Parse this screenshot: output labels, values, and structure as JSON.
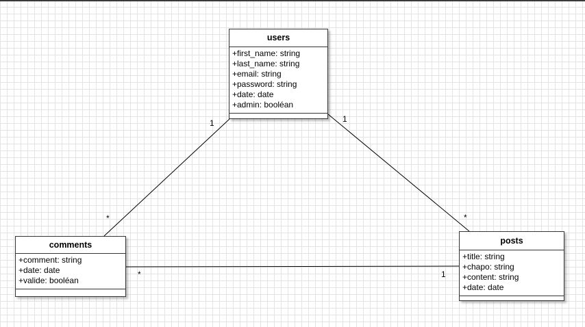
{
  "classes": {
    "users": {
      "name": "users",
      "attributes": [
        "+first_name: string",
        "+last_name: string",
        "+email: string",
        "+password: string",
        "+date: date",
        "+admin: booléan"
      ]
    },
    "comments": {
      "name": "comments",
      "attributes": [
        "+comment: string",
        "+date: date",
        "+valide: booléan"
      ]
    },
    "posts": {
      "name": "posts",
      "attributes": [
        "+title: string",
        "+chapo: string",
        "+content: string",
        "+date: date"
      ]
    }
  },
  "associations": {
    "users_comments": {
      "users_end": "1",
      "comments_end": "*"
    },
    "users_posts": {
      "users_end": "1",
      "posts_end": "*"
    },
    "comments_posts": {
      "comments_end": "*",
      "posts_end": "1"
    }
  }
}
